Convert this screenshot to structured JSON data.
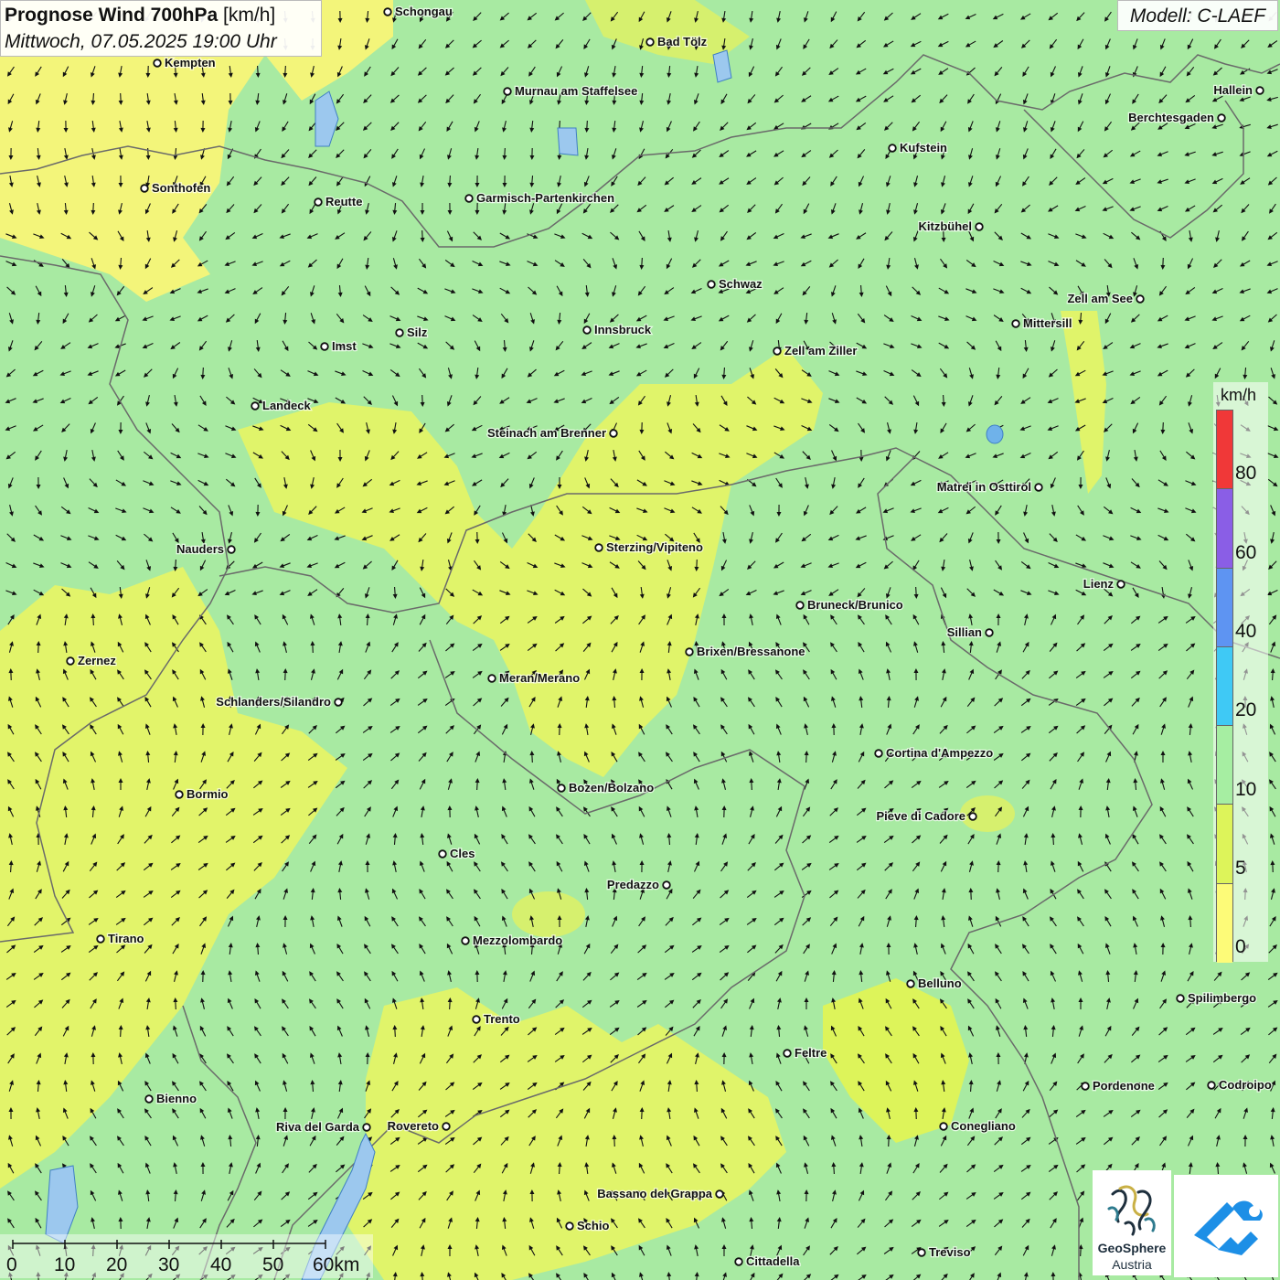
{
  "header": {
    "title_bold": "Prognose Wind 700hPa",
    "title_unit": " [km/h]",
    "datetime": "Mittwoch, 07.05.2025 19:00 Uhr",
    "model": "Modell: C-LAEF"
  },
  "legend": {
    "unit": "km/h",
    "labels": [
      "80",
      "60",
      "40",
      "20",
      "10",
      "5",
      "0"
    ],
    "colors": [
      "#f03838",
      "#8a5ee6",
      "#5e94f2",
      "#3fc9f5",
      "#a6eea2",
      "#ddf45a",
      "#fdfb78"
    ]
  },
  "scale_bar": {
    "labels": [
      "0",
      "10",
      "20",
      "30",
      "40",
      "50",
      "60km"
    ]
  },
  "logos": {
    "geosphere_line1": "GeoSphere",
    "geosphere_line2": "Austria"
  },
  "cities": [
    {
      "name": "Schongau"
    },
    {
      "name": "Bad Tölz"
    },
    {
      "name": "Kempten"
    },
    {
      "name": "Murnau am Staffelsee"
    },
    {
      "name": "Hallein"
    },
    {
      "name": "Berchtesgaden"
    },
    {
      "name": "Kufstein"
    },
    {
      "name": "Sonthofen"
    },
    {
      "name": "Reutte"
    },
    {
      "name": "Garmisch-Partenkirchen"
    },
    {
      "name": "Kitzbühel"
    },
    {
      "name": "Schwaz"
    },
    {
      "name": "Zell am See"
    },
    {
      "name": "Mittersill"
    },
    {
      "name": "Silz"
    },
    {
      "name": "Innsbruck"
    },
    {
      "name": "Imst"
    },
    {
      "name": "Zell am Ziller"
    },
    {
      "name": "Landeck"
    },
    {
      "name": "Steinach am Brenner"
    },
    {
      "name": "Matrei in Osttirol"
    },
    {
      "name": "Nauders"
    },
    {
      "name": "Sterzing/Vipiteno"
    },
    {
      "name": "Lienz"
    },
    {
      "name": "Bruneck/Brunico"
    },
    {
      "name": "Sillian"
    },
    {
      "name": "Zernez"
    },
    {
      "name": "Brixen/Bressanone"
    },
    {
      "name": "Meran/Merano"
    },
    {
      "name": "Schlanders/Silandro"
    },
    {
      "name": "Cortina d'Ampezzo"
    },
    {
      "name": "Bozen/Bolzano"
    },
    {
      "name": "Bormio"
    },
    {
      "name": "Pieve di Cadore"
    },
    {
      "name": "Cles"
    },
    {
      "name": "Predazzo"
    },
    {
      "name": "Tirano"
    },
    {
      "name": "Mezzolombardo"
    },
    {
      "name": "Belluno"
    },
    {
      "name": "Spilimbergo"
    },
    {
      "name": "Trento"
    },
    {
      "name": "Feltre"
    },
    {
      "name": "Pordenone"
    },
    {
      "name": "Codroipo"
    },
    {
      "name": "Bienno"
    },
    {
      "name": "Riva del Garda"
    },
    {
      "name": "Rovereto"
    },
    {
      "name": "Conegliano"
    },
    {
      "name": "Bassano del Grappa"
    },
    {
      "name": "Schio"
    },
    {
      "name": "Treviso"
    },
    {
      "name": "Cittadella"
    }
  ]
}
